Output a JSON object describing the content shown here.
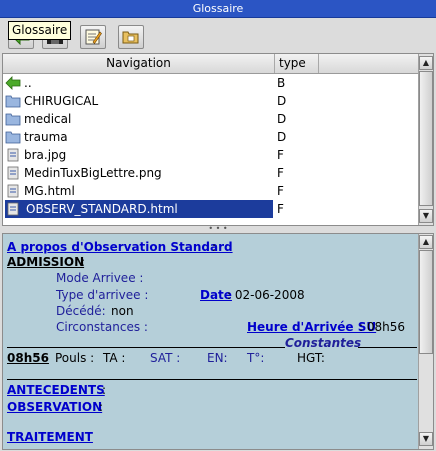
{
  "window": {
    "title": "Glossaire"
  },
  "toolbar": {
    "tooltip": "Glossaire",
    "buttons": [
      {
        "icon": "back-arrow-icon"
      },
      {
        "icon": "save-disk-icon"
      },
      {
        "icon": "edit-note-icon"
      },
      {
        "icon": "open-folder-icon"
      }
    ]
  },
  "list": {
    "columns": {
      "navigation": "Navigation",
      "type": "type"
    },
    "rows": [
      {
        "name": "..",
        "type": "B",
        "icon": "up-arrow-icon"
      },
      {
        "name": "CHIRUGICAL",
        "type": "D",
        "icon": "folder-icon"
      },
      {
        "name": "medical",
        "type": "D",
        "icon": "folder-icon"
      },
      {
        "name": "trauma",
        "type": "D",
        "icon": "folder-icon"
      },
      {
        "name": "bra.jpg",
        "type": "F",
        "icon": "file-icon"
      },
      {
        "name": "MedinTuxBigLettre.png",
        "type": "F",
        "icon": "file-icon"
      },
      {
        "name": "MG.html",
        "type": "F",
        "icon": "file-icon"
      },
      {
        "name": "OBSERV_STANDARD.html",
        "type": "F",
        "icon": "file-icon",
        "selected": true
      }
    ]
  },
  "splitter": {
    "grip": "• • •"
  },
  "document": {
    "about_link": "A propos d'Observation Standard",
    "about_colon": " :",
    "admission": "ADMISSION",
    "admission_colon": ":",
    "mode_arrivee": "Mode Arrivee :",
    "type_arrivee": "Type d'arrivee :",
    "date_link": "Date",
    "date_value": ":  02-06-2008",
    "decede": "Décédé:",
    "decede_value": "non",
    "circonstances": "Circonstances :",
    "heure_link": "Heure d'Arrivée SU",
    "heure_value": ":     08h56",
    "constantes": "Constantes",
    "time": "08h56",
    "pouls": "Pouls :",
    "ta": "TA :",
    "sat": "SAT :",
    "en": "EN:",
    "temp": "T°:",
    "hgt": "HGT:",
    "antecedents": "ANTECEDENTS",
    "antecedents_colon": ":",
    "observation": "OBSERVATION",
    "observation_colon": ":",
    "traitement": "TRAITEMENT"
  }
}
